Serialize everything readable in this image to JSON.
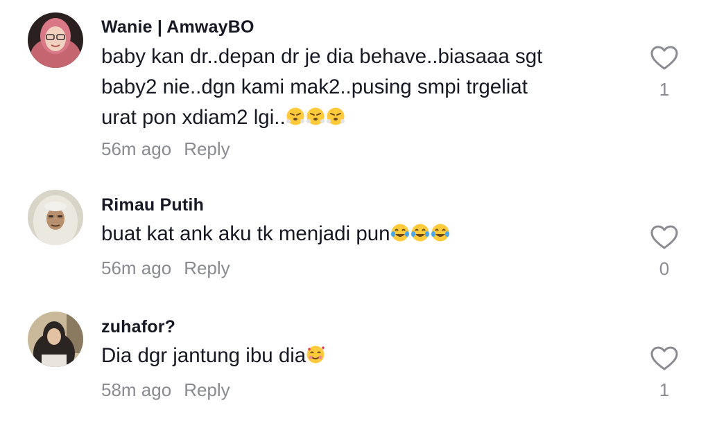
{
  "comments": [
    {
      "username": "Wanie | AmwayBO",
      "lines": [
        "baby kan dr..depan dr je dia behave..biasaaa sgt",
        "baby2 nie..dgn kami mak2..pusing smpi trgeliat",
        "urat pon xdiam2 lgi.."
      ],
      "emojis": [
        "face-with-steam-from-nose",
        "face-with-steam-from-nose",
        "face-with-steam-from-nose"
      ],
      "time": "56m ago",
      "reply_label": "Reply",
      "like_count": "1"
    },
    {
      "username": "Rimau Putih",
      "lines": [
        "buat kat ank aku tk menjadi pun"
      ],
      "emojis": [
        "face-with-tears-of-joy",
        "face-with-tears-of-joy",
        "face-with-tears-of-joy"
      ],
      "time": "56m ago",
      "reply_label": "Reply",
      "like_count": "0"
    },
    {
      "username": "zuhafor?",
      "lines": [
        "Dia dgr jantung ibu dia"
      ],
      "emojis": [
        "smiling-face-with-hearts"
      ],
      "time": "58m ago",
      "reply_label": "Reply",
      "like_count": "1"
    }
  ],
  "colors": {
    "username": "#161823",
    "text": "#161823",
    "secondary": "#8a8b91",
    "heart_outline": "#8a8b91"
  },
  "icons": {
    "like": "heart-outline-icon"
  }
}
